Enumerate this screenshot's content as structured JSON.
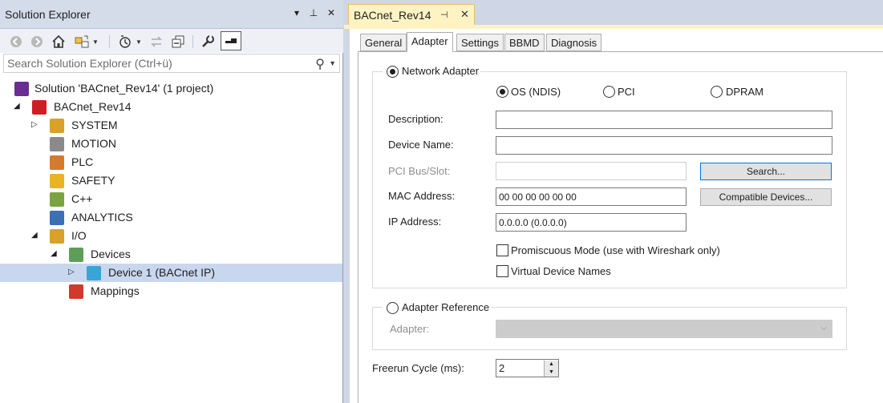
{
  "solution_explorer": {
    "title": "Solution Explorer",
    "title_buttons": [
      "▾",
      "⊥",
      "✕"
    ],
    "search": {
      "placeholder": "Search Solution Explorer (Ctrl+ü)"
    },
    "tree": [
      {
        "label": "Solution 'BACnet_Rev14' (1 project)",
        "expander": "",
        "icon": "solution-icon",
        "color": "#6a2d91"
      },
      {
        "label": "BACnet_Rev14",
        "expander": "◢",
        "icon": "project-icon",
        "color": "#cc1f24"
      },
      {
        "label": "SYSTEM",
        "expander": "▷",
        "icon": "system-icon",
        "color": "#d9a02a"
      },
      {
        "label": "MOTION",
        "expander": "",
        "icon": "motion-icon",
        "color": "#8a8a8a"
      },
      {
        "label": "PLC",
        "expander": "",
        "icon": "plc-icon",
        "color": "#d77a2b"
      },
      {
        "label": "SAFETY",
        "expander": "",
        "icon": "safety-icon",
        "color": "#e8b424"
      },
      {
        "label": "C++",
        "expander": "",
        "icon": "cpp-icon",
        "color": "#7ba33f"
      },
      {
        "label": "ANALYTICS",
        "expander": "",
        "icon": "analytics-icon",
        "color": "#3b6fb6"
      },
      {
        "label": "I/O",
        "expander": "◢",
        "icon": "io-icon",
        "color": "#d9a02a"
      },
      {
        "label": "Devices",
        "expander": "◢",
        "icon": "devices-icon",
        "color": "#5f9e5a"
      },
      {
        "label": "Device 1 (BACnet IP)",
        "expander": "▷",
        "icon": "bacnet-icon",
        "color": "#3aa3d8"
      },
      {
        "label": "Mappings",
        "expander": "",
        "icon": "mappings-icon",
        "color": "#d0392b"
      }
    ]
  },
  "editor": {
    "doc_tab": {
      "title": "BACnet_Rev14",
      "pin": "⊣",
      "close": "✕"
    },
    "tabs": [
      "General",
      "Adapter",
      "Settings",
      "BBMD",
      "Diagnosis"
    ],
    "active_tab": "Adapter",
    "network_adapter": {
      "label": "Network Adapter",
      "options": [
        "OS (NDIS)",
        "PCI",
        "DPRAM"
      ],
      "description_label": "Description:",
      "description_value": "",
      "device_name_label": "Device Name:",
      "device_name_value": "",
      "pci_label": "PCI Bus/Slot:",
      "pci_value": "",
      "search_button": "Search...",
      "mac_label": "MAC Address:",
      "mac_value": "00 00 00 00 00 00",
      "compatible_button": "Compatible Devices...",
      "ip_label": "IP Address:",
      "ip_value": "0.0.0.0 (0.0.0.0)",
      "promiscuous_label": "Promiscuous Mode (use with Wireshark only)",
      "virtual_names_label": "Virtual Device Names"
    },
    "adapter_reference": {
      "label": "Adapter Reference",
      "adapter_label": "Adapter:",
      "adapter_value": ""
    },
    "freerun": {
      "label": "Freerun Cycle (ms):",
      "value": "2"
    }
  }
}
